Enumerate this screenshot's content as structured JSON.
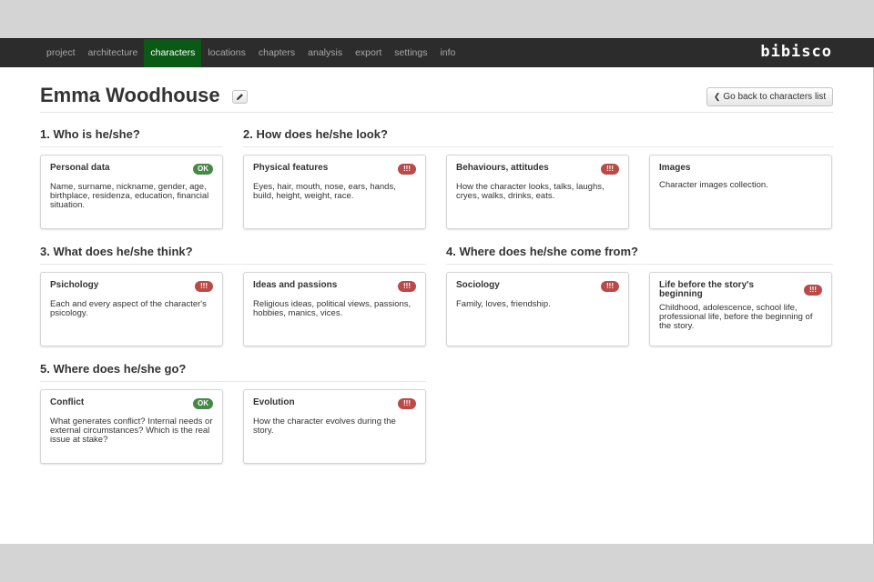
{
  "navbar": {
    "items": [
      {
        "label": "project"
      },
      {
        "label": "architecture"
      },
      {
        "label": "characters"
      },
      {
        "label": "locations"
      },
      {
        "label": "chapters"
      },
      {
        "label": "analysis"
      },
      {
        "label": "export"
      },
      {
        "label": "settings"
      },
      {
        "label": "info"
      }
    ],
    "active": "characters",
    "brand": "bibisco"
  },
  "header": {
    "title": "Emma Woodhouse",
    "edit_icon": "pencil-icon",
    "back_label": "Go back to characters list",
    "back_icon": "chevron-left-icon"
  },
  "sections": [
    {
      "title": "1. Who is he/she?"
    },
    {
      "title": "2. How does he/she look?"
    },
    {
      "title": "3. What does he/she think?"
    },
    {
      "title": "4. Where does he/she come from?"
    },
    {
      "title": "5. Where does he/she go?"
    }
  ],
  "cards": [
    {
      "title": "Personal data",
      "badge": "OK",
      "status": "ok",
      "desc": "Name, surname, nickname, gender, age, birthplace, residenza, education, financial situation."
    },
    {
      "title": "Physical features",
      "badge": "!!!",
      "status": "todo",
      "desc": "Eyes, hair, mouth, nose, ears, hands, build, height, weight, race."
    },
    {
      "title": "Behaviours, attitudes",
      "badge": "!!!",
      "status": "todo",
      "desc": "How the character looks, talks, laughs, cryes, walks, drinks, eats."
    },
    {
      "title": "Images",
      "badge": "",
      "status": "none",
      "desc": "Character images collection."
    },
    {
      "title": "Psichology",
      "badge": "!!!",
      "status": "todo",
      "desc": "Each and every aspect of the character's psicology."
    },
    {
      "title": "Ideas and passions",
      "badge": "!!!",
      "status": "todo",
      "desc": "Religious ideas, political views, passions, hobbies, manics, vices."
    },
    {
      "title": "Sociology",
      "badge": "!!!",
      "status": "todo",
      "desc": "Family, loves, friendship."
    },
    {
      "title": "Life before the story's beginning",
      "badge": "!!!",
      "status": "todo",
      "desc": "Childhood, adolescence, school life, professional life, before the beginning of the story."
    },
    {
      "title": "Conflict",
      "badge": "OK",
      "status": "ok",
      "desc": "What generates conflict? Internal needs or external circumstances? Which is the real issue at stake?"
    },
    {
      "title": "Evolution",
      "badge": "!!!",
      "status": "todo",
      "desc": "How the character evolves during the story."
    }
  ],
  "colors": {
    "navbar_bg": "#2c2c2c",
    "nav_active": "#0a5a16",
    "badge_ok": "#468847",
    "badge_todo": "#b94a48"
  }
}
